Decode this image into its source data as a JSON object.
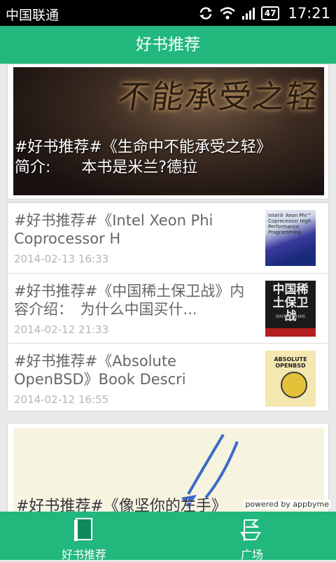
{
  "status_bar": {
    "carrier": "中国联通",
    "battery": "47",
    "time": "17:21",
    "icons": [
      "sync-icon",
      "wifi-icon",
      "signal-icon",
      "battery-icon"
    ]
  },
  "header": {
    "title": "好书推荐"
  },
  "featured": {
    "cover_text": "不能承受之轻",
    "line1": "#好书推荐#《生命中不能承受之轻》",
    "line2": "简介:　　本书是米兰?德拉"
  },
  "list": [
    {
      "title": "#好书推荐#《Intel Xeon Phi Coprocessor H",
      "date": "2014-02-13 16:33",
      "thumb_text": "Intel® Xeon Phi™ Coprocessor High Performance Programming"
    },
    {
      "title": "#好书推荐#《中国稀土保卫战》内容介绍：　为什么中国买什...",
      "date": "2014-02-12 21:33",
      "thumb_text": "中国稀土保卫战",
      "thumb_subtext": "BAOWEIZHAN"
    },
    {
      "title": "#好书推荐#《Absolute OpenBSD》Book Descri",
      "date": "2014-02-12 16:55",
      "thumb_text": "ABSOLUTE OPENBSD"
    }
  ],
  "second": {
    "title": "#好书推荐#《像坚你的左手》"
  },
  "powered_by": "powered by appbyme",
  "bottom_nav": [
    {
      "label": "好书推荐",
      "icon": "book-icon",
      "active": true
    },
    {
      "label": "广场",
      "icon": "flag-icon",
      "active": false
    }
  ],
  "colors": {
    "accent": "#21b77d",
    "background": "#e9e9e9",
    "date": "#b5b5b5",
    "title": "#666666"
  }
}
